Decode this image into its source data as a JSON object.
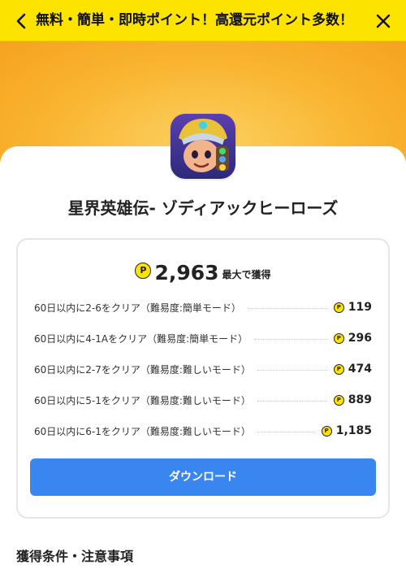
{
  "header": {
    "title": "無料・簡単・即時ポイント！高還元ポイント多数！"
  },
  "app": {
    "name": "星界英雄伝- ゾディアックヒーローズ"
  },
  "reward": {
    "max_points": "2,963",
    "max_suffix": "最大で獲得",
    "coin_symbol": "P"
  },
  "tasks": [
    {
      "label": "60日以内に2-6をクリア（難易度:簡単モード）",
      "points": "119"
    },
    {
      "label": "60日以内に4-1Aをクリア（難易度:簡単モード）",
      "points": "296"
    },
    {
      "label": "60日以内に2-7をクリア（難易度:難しいモード）",
      "points": "474"
    },
    {
      "label": "60日以内に5-1をクリア（難易度:難しいモード）",
      "points": "889"
    },
    {
      "label": "60日以内に6-1をクリア（難易度:難しいモード）",
      "points": "1,185"
    }
  ],
  "download_button": "ダウンロード",
  "conditions_title": "獲得条件・注意事項",
  "colors": {
    "header_bg": "#fde400",
    "hero_orange": "#f9b531",
    "button_blue": "#3a86f0",
    "coin_yellow": "#fde400"
  }
}
